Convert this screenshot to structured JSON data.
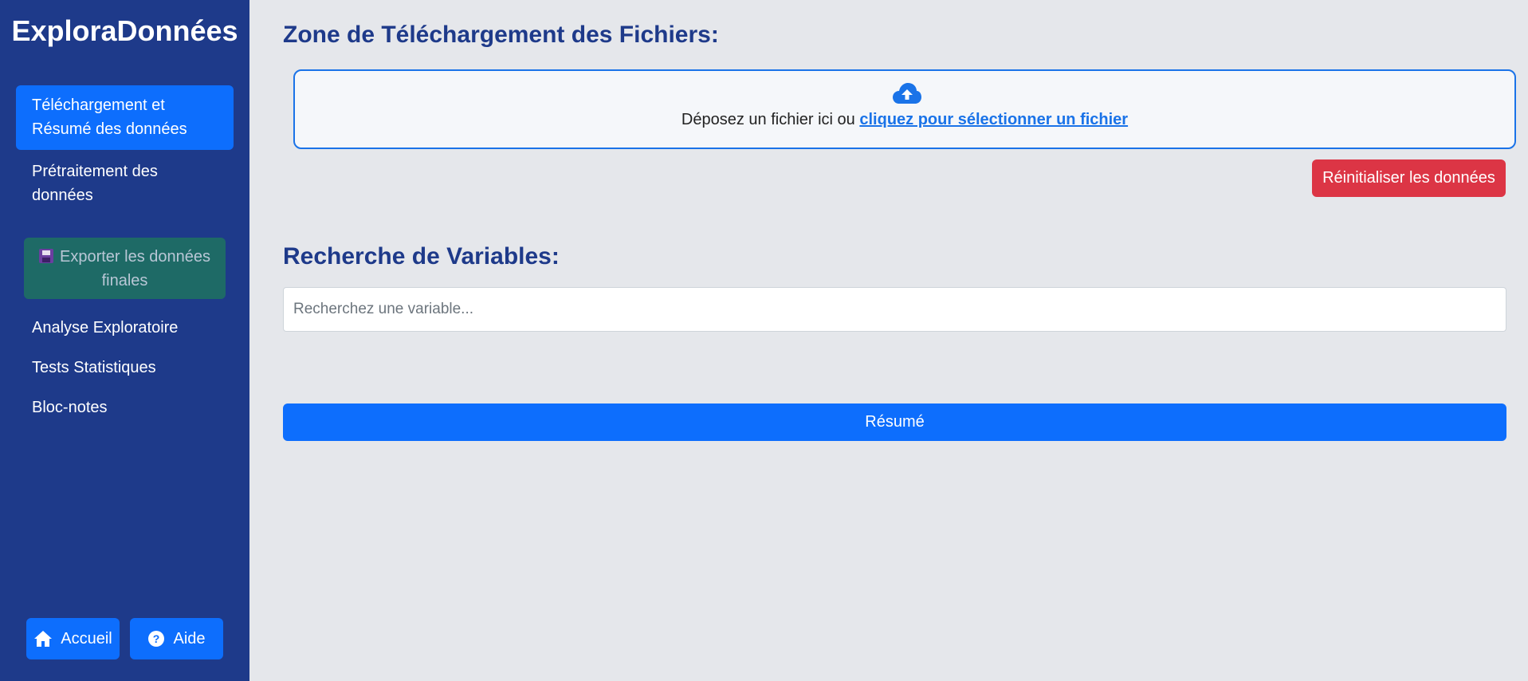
{
  "app": {
    "brand": "ExploraDonnées"
  },
  "sidebar": {
    "items": [
      {
        "label": "Téléchargement et Résumé des données",
        "active": true
      },
      {
        "label": "Prétraitement des données",
        "active": false
      },
      {
        "label": "Analyse Exploratoire",
        "active": false
      },
      {
        "label": "Tests Statistiques",
        "active": false
      },
      {
        "label": "Bloc-notes",
        "active": false
      }
    ],
    "export_label": "Exporter les données finales",
    "export_icon": "floppy-disk-icon",
    "home_label": "Accueil",
    "help_label": "Aide"
  },
  "upload": {
    "title": "Zone de Téléchargement des Fichiers:",
    "drop_text": "Déposez un fichier ici ou ",
    "drop_link": "cliquez pour sélectionner un fichier",
    "icon": "cloud-upload-icon"
  },
  "reset_label": "Réinitialiser les données",
  "search": {
    "title": "Recherche de Variables:",
    "placeholder": "Recherchez une variable..."
  },
  "summary_label": "Résumé",
  "colors": {
    "sidebar_bg": "#1e3a8a",
    "primary": "#0d6efd",
    "danger": "#dc3545",
    "export_bg": "#1e6a66",
    "page_bg": "#e5e7eb"
  }
}
